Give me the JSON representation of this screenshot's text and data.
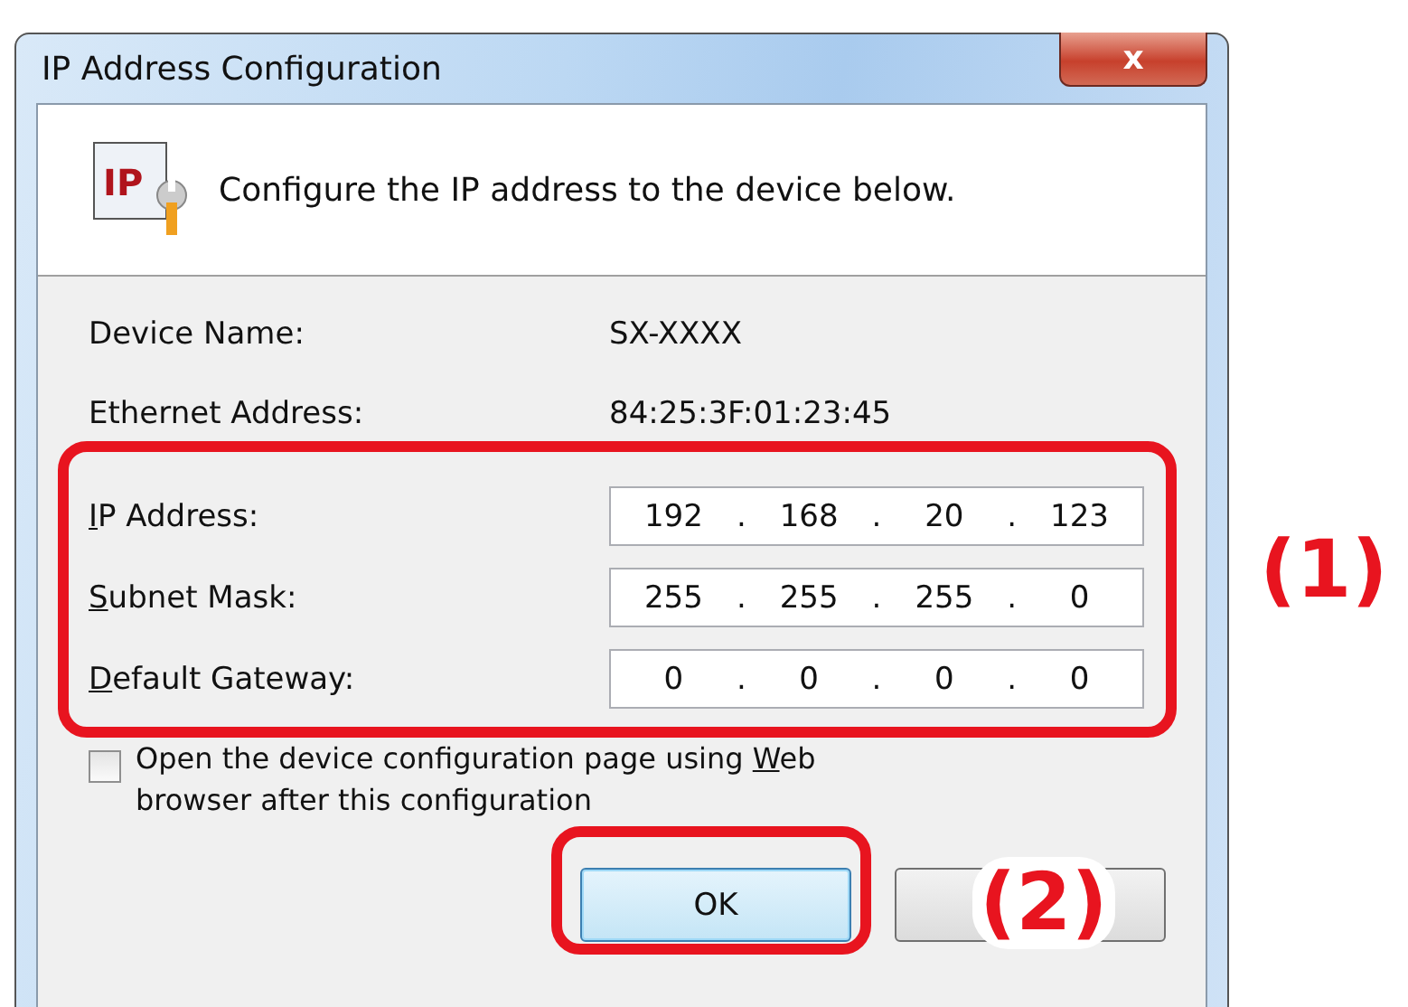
{
  "window": {
    "title": "IP Address Configuration",
    "close": "x"
  },
  "header": {
    "icon_text": "IP",
    "message": "Configure the IP address to the device below."
  },
  "info": [
    {
      "label": "Device Name:",
      "value": "SX-XXXX"
    },
    {
      "label": "Ethernet Address:",
      "value": "84:25:3F:01:23:45"
    }
  ],
  "fields": [
    {
      "label": {
        "key": "I",
        "after": "P Address:"
      },
      "octets": [
        "192",
        "168",
        "20",
        "123"
      ]
    },
    {
      "label": {
        "key": "S",
        "after": "ubnet Mask:"
      },
      "octets": [
        "255",
        "255",
        "255",
        "0"
      ]
    },
    {
      "label": {
        "key": "D",
        "after": "efault Gateway:"
      },
      "octets": [
        "0",
        "0",
        "0",
        "0"
      ]
    }
  ],
  "separator": ".",
  "checkbox": {
    "checked": false,
    "label": {
      "before": "Open the device configuration page using ",
      "key": "W",
      "after": "eb browser after this configuration"
    }
  },
  "buttons": [
    {
      "kind": "text",
      "label": "OK",
      "default": true
    },
    {
      "kind": "blank"
    }
  ],
  "annotations": [
    {
      "label": "(1)"
    },
    {
      "label": "(2)"
    }
  ]
}
